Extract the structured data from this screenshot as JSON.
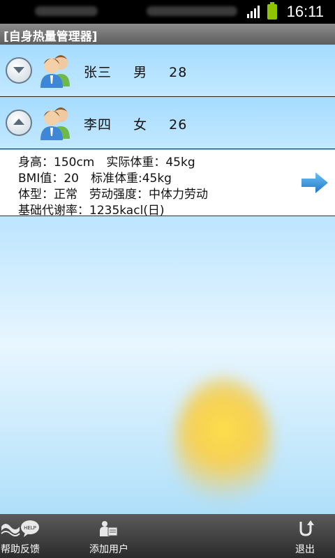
{
  "status_bar": {
    "time": "16:11"
  },
  "app": {
    "title": "[自身热量管理器]"
  },
  "users": [
    {
      "name": "张三",
      "gender": "男",
      "age": "28",
      "expanded": false
    },
    {
      "name": "李四",
      "gender": "女",
      "age": "26",
      "expanded": true
    }
  ],
  "details": {
    "line1": "身高：150cm　实际体重：45kg",
    "line2": "BMI值：20　标准体重:45kg",
    "line3": "体型：正常　劳动强度：中体力劳动",
    "line4": "基础代谢率：1235kacl(日)"
  },
  "bottom_nav": [
    {
      "label": "反馈",
      "icon": "help-bubble-icon"
    },
    {
      "label": "添加用户",
      "icon": "add-user-icon"
    },
    {
      "label": "帮助",
      "icon": "help-wave-icon"
    },
    {
      "label": "退出",
      "icon": "exit-icon"
    }
  ],
  "colors": {
    "accent_blue": "#2e8ad8",
    "battery": "#8ec400"
  }
}
